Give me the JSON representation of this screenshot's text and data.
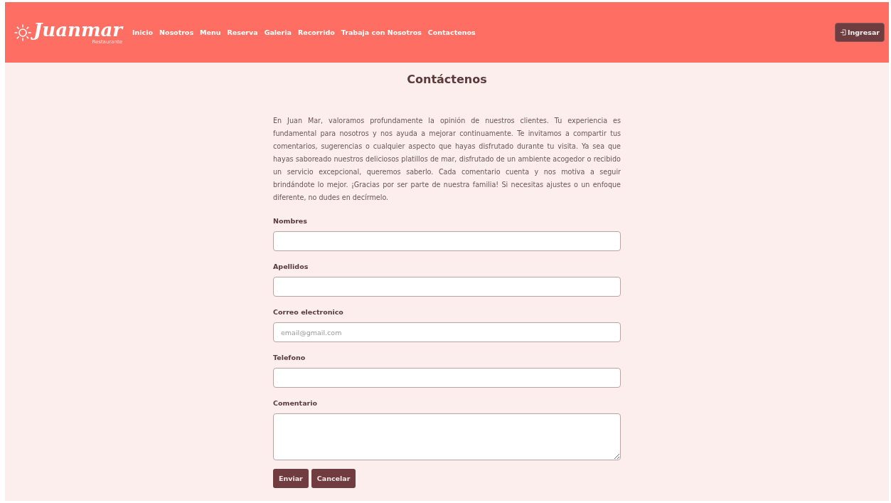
{
  "header": {
    "logo": "Juanmar",
    "logo_subtitle": "Restaurante",
    "nav": [
      "Inicio",
      "Nosotros",
      "Menu",
      "Reserva",
      "Galeria",
      "Recorrido",
      "Trabaja con Nosotros",
      "Contactenos"
    ],
    "login_button": "Ingresar"
  },
  "title": "Contáctenos",
  "intro": "En Juan Mar, valoramos profundamente la opinión de nuestros clientes. Tu experiencia es fundamental para nosotros y nos ayuda a mejorar continuamente. Te invitamos a compartir tus comentarios, sugerencias o cualquier aspecto que hayas disfrutado durante tu visita. Ya sea que hayas saboreado nuestros deliciosos platillos de mar, disfrutado de un ambiente acogedor o recibido un servicio excepcional, queremos saberlo. Cada comentario cuenta y nos motiva a seguir brindándote lo mejor. ¡Gracias por ser parte de nuestra familia! Si necesitas ajustes o un enfoque diferente, no dudes en decírmelo.",
  "fields": [
    {
      "label": "Nombres",
      "kind": "text"
    },
    {
      "label": "Apellidos",
      "kind": "text"
    },
    {
      "label": "Correo electronico",
      "kind": "text",
      "placeholder": "email@gmail.com"
    },
    {
      "label": "Telefono",
      "kind": "text"
    },
    {
      "label": "Comentario",
      "kind": "textarea"
    }
  ],
  "buttons": [
    "Enviar",
    "Cancelar"
  ]
}
